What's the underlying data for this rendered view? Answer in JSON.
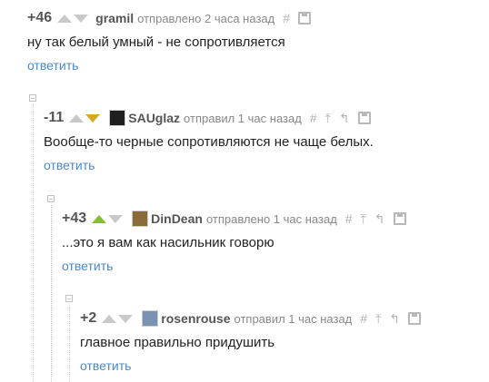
{
  "comments": [
    {
      "rating": "+46",
      "vote": "none",
      "username": "gramil",
      "sent": "отправлено 2 часа назад",
      "text": "ну так белый умный - не сопротивляется",
      "reply": "ответить",
      "has_avatar": false
    },
    {
      "rating": "-11",
      "vote": "down",
      "username": "SAUglaz",
      "sent": "отправил 1 час назад",
      "text": "Вообще-то черные сопротивляются не чаще белых.",
      "reply": "ответить",
      "has_avatar": true,
      "avatar_color": "#1e1e1e"
    },
    {
      "rating": "+43",
      "vote": "up",
      "username": "DinDean",
      "sent": "отправлено 1 час назад",
      "text": "...это я вам как насильник говорю",
      "reply": "ответить",
      "has_avatar": true,
      "avatar_color": "#8a6a3a"
    },
    {
      "rating": "+2",
      "vote": "none",
      "username": "rosenrouse",
      "sent": "отправил 1 час назад",
      "text": "главное правильно придушить",
      "reply": "ответить",
      "has_avatar": true,
      "avatar_color": "#7a93b3"
    }
  ],
  "icons": {
    "link": "#",
    "up_thread": "⤒",
    "parent": "↰",
    "save": "save-icon"
  }
}
